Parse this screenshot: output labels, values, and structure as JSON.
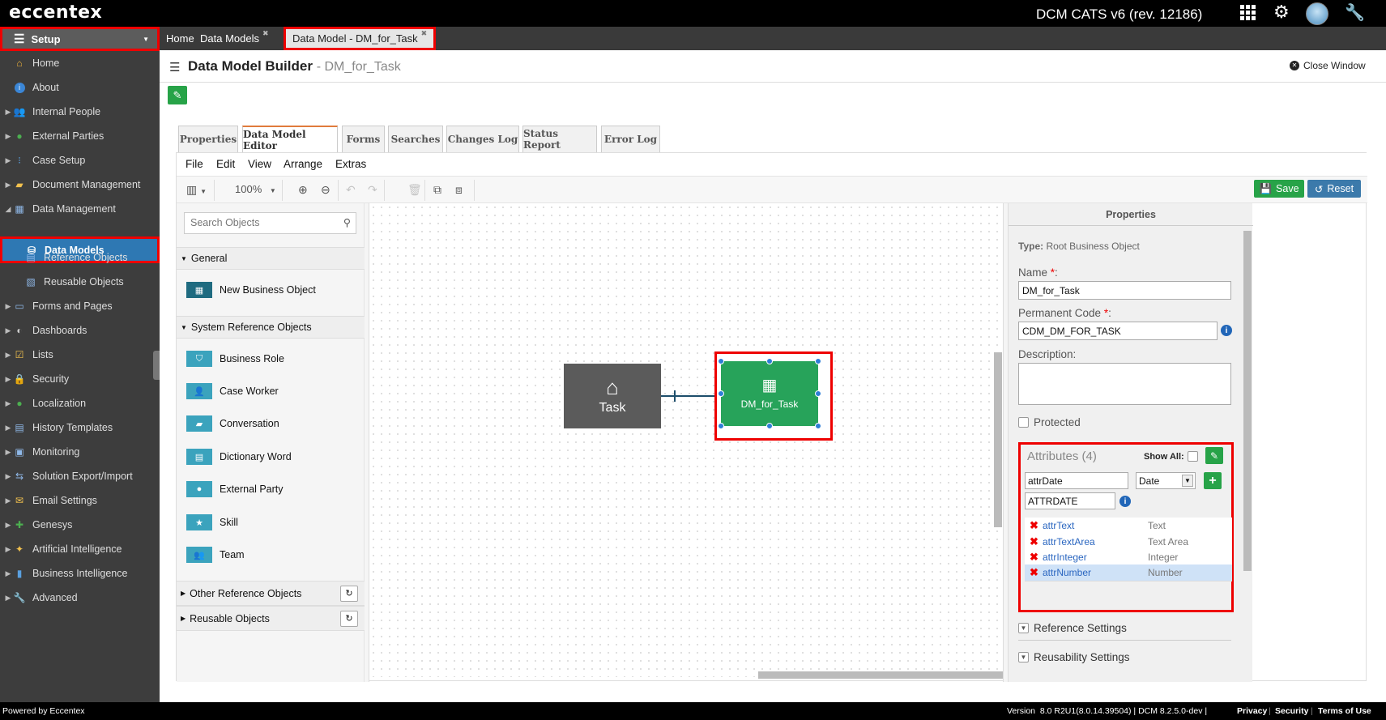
{
  "app": {
    "logo": "eccentex",
    "title": "DCM CATS v6 (rev. 12186)"
  },
  "sidebar": {
    "setup_label": "Setup",
    "items": [
      {
        "label": "Home",
        "icon": "house-icon"
      },
      {
        "label": "About",
        "icon": "info-icon"
      },
      {
        "label": "Internal People",
        "icon": "people-icon"
      },
      {
        "label": "External Parties",
        "icon": "globe-icon"
      },
      {
        "label": "Case Setup",
        "icon": "hierarchy-icon"
      },
      {
        "label": "Document Management",
        "icon": "folder-icon"
      },
      {
        "label": "Data Management",
        "icon": "table-icon"
      },
      {
        "label": "Data Models",
        "icon": "database-icon"
      },
      {
        "label": "Reference Objects",
        "icon": "list-icon"
      },
      {
        "label": "Reusable Objects",
        "icon": "reusable-icon"
      },
      {
        "label": "Forms and Pages",
        "icon": "form-icon"
      },
      {
        "label": "Dashboards",
        "icon": "gauge-icon"
      },
      {
        "label": "Lists",
        "icon": "checklist-icon"
      },
      {
        "label": "Security",
        "icon": "lock-icon"
      },
      {
        "label": "Localization",
        "icon": "globe-icon"
      },
      {
        "label": "History Templates",
        "icon": "history-icon"
      },
      {
        "label": "Monitoring",
        "icon": "monitor-icon"
      },
      {
        "label": "Solution Export/Import",
        "icon": "export-icon"
      },
      {
        "label": "Email Settings",
        "icon": "email-icon"
      },
      {
        "label": "Genesys",
        "icon": "puzzle-icon"
      },
      {
        "label": "Artificial Intelligence",
        "icon": "wand-icon"
      },
      {
        "label": "Business Intelligence",
        "icon": "bar-chart-icon"
      },
      {
        "label": "Advanced",
        "icon": "wrench-icon"
      }
    ]
  },
  "tabs": {
    "home": "Home",
    "data_models": "Data Models",
    "active": "Data Model - DM_for_Task"
  },
  "header": {
    "title": "Data Model Builder",
    "subtitle": "- DM_for_Task",
    "close_window": "Close Window"
  },
  "page_tabs": [
    "Properties",
    "Data Model Editor",
    "Forms",
    "Searches",
    "Changes Log",
    "Status Report",
    "Error Log"
  ],
  "menu": [
    "File",
    "Edit",
    "View",
    "Arrange",
    "Extras"
  ],
  "toolbar": {
    "zoom": "100%",
    "save": "Save",
    "reset": "Reset"
  },
  "palette": {
    "search_placeholder": "Search Objects",
    "general": "General",
    "new_bo": "New Business Object",
    "system_ref": "System Reference Objects",
    "system_items": [
      "Business Role",
      "Case Worker",
      "Conversation",
      "Dictionary Word",
      "External Party",
      "Skill",
      "Team"
    ],
    "other_ref": "Other Reference Objects",
    "reusable": "Reusable Objects"
  },
  "canvas": {
    "task_label": "Task",
    "dm_label": "DM_for_Task"
  },
  "properties": {
    "header": "Properties",
    "type_label": "Type:",
    "type_value": "Root Business Object",
    "name_label": "Name",
    "name_value": "DM_for_Task",
    "code_label": "Permanent Code",
    "code_value": "CDM_DM_FOR_TASK",
    "desc_label": "Description:",
    "protected_label": "Protected",
    "attributes_title": "Attributes (4)",
    "show_all": "Show All:",
    "new_attr_name": "attrDate",
    "new_attr_type": "Date",
    "new_attr_code": "ATTRDATE",
    "attributes": [
      {
        "name": "attrText",
        "type": "Text"
      },
      {
        "name": "attrTextArea",
        "type": "Text Area"
      },
      {
        "name": "attrInteger",
        "type": "Integer"
      },
      {
        "name": "attrNumber",
        "type": "Number"
      }
    ],
    "reference_settings": "Reference Settings",
    "reusability_settings": "Reusability Settings"
  },
  "footer": {
    "powered": "Powered by Eccentex",
    "version": "Version  8.0 R2U1(8.0.14.39504) | DCM 8.2.5.0-dev |",
    "privacy": "Privacy",
    "security": "Security",
    "terms": "Terms of Use"
  }
}
